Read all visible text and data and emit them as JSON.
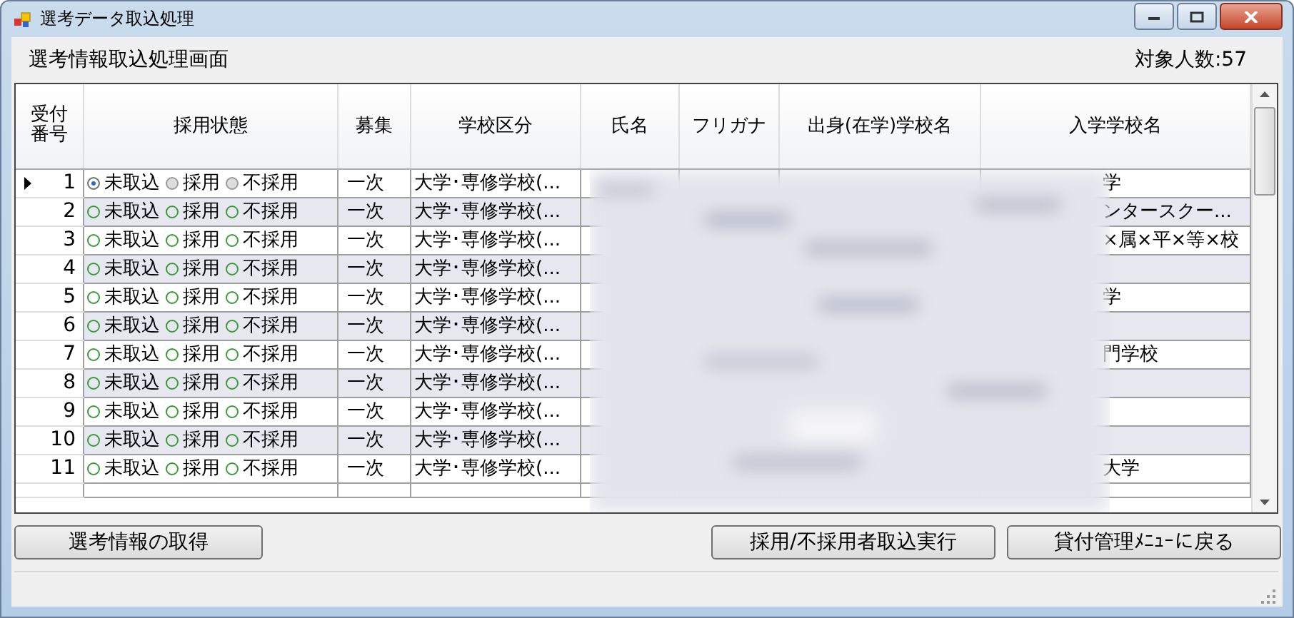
{
  "window": {
    "title": "選考データ取込処理"
  },
  "heading": "選考情報取込処理画面",
  "target_count": "対象人数:57",
  "table": {
    "columns": [
      "受付番号",
      "採用状態",
      "募集",
      "学校区分",
      "氏名",
      "フリガナ",
      "出身(在学)学校名",
      "入学学校名"
    ],
    "rows": [
      {
        "number": "1",
        "current": true,
        "options": [
          {
            "label": "未取込",
            "selected": true
          },
          {
            "label": "採用",
            "selected": false
          },
          {
            "label": "不採用",
            "selected": false
          }
        ],
        "recruitment": "一次",
        "school_type": "大学･専修学校(...",
        "admission_school": "学"
      },
      {
        "number": "2",
        "current": false,
        "options": [
          {
            "label": "未取込",
            "selected": false
          },
          {
            "label": "採用",
            "selected": false
          },
          {
            "label": "不採用",
            "selected": false
          }
        ],
        "recruitment": "一次",
        "school_type": "大学･専修学校(...",
        "admission_school": "ンタースクー..."
      },
      {
        "number": "3",
        "current": false,
        "options": [
          {
            "label": "未取込",
            "selected": false
          },
          {
            "label": "採用",
            "selected": false
          },
          {
            "label": "不採用",
            "selected": false
          }
        ],
        "recruitment": "一次",
        "school_type": "大学･専修学校(...",
        "admission_school": "×属×平×等×校"
      },
      {
        "number": "4",
        "current": false,
        "options": [
          {
            "label": "未取込",
            "selected": false
          },
          {
            "label": "採用",
            "selected": false
          },
          {
            "label": "不採用",
            "selected": false
          }
        ],
        "recruitment": "一次",
        "school_type": "大学･専修学校(..."
      },
      {
        "number": "5",
        "current": false,
        "options": [
          {
            "label": "未取込",
            "selected": false
          },
          {
            "label": "採用",
            "selected": false
          },
          {
            "label": "不採用",
            "selected": false
          }
        ],
        "recruitment": "一次",
        "school_type": "大学･専修学校(...",
        "admission_school": "学"
      },
      {
        "number": "6",
        "current": false,
        "options": [
          {
            "label": "未取込",
            "selected": false
          },
          {
            "label": "採用",
            "selected": false
          },
          {
            "label": "不採用",
            "selected": false
          }
        ],
        "recruitment": "一次",
        "school_type": "大学･専修学校(..."
      },
      {
        "number": "7",
        "current": false,
        "options": [
          {
            "label": "未取込",
            "selected": false
          },
          {
            "label": "採用",
            "selected": false
          },
          {
            "label": "不採用",
            "selected": false
          }
        ],
        "recruitment": "一次",
        "school_type": "大学･専修学校(...",
        "admission_school": "門学校"
      },
      {
        "number": "8",
        "current": false,
        "options": [
          {
            "label": "未取込",
            "selected": false
          },
          {
            "label": "採用",
            "selected": false
          },
          {
            "label": "不採用",
            "selected": false
          }
        ],
        "recruitment": "一次",
        "school_type": "大学･専修学校(..."
      },
      {
        "number": "9",
        "current": false,
        "options": [
          {
            "label": "未取込",
            "selected": false
          },
          {
            "label": "採用",
            "selected": false
          },
          {
            "label": "不採用",
            "selected": false
          }
        ],
        "recruitment": "一次",
        "school_type": "大学･専修学校(..."
      },
      {
        "number": "10",
        "current": false,
        "options": [
          {
            "label": "未取込",
            "selected": false
          },
          {
            "label": "採用",
            "selected": false
          },
          {
            "label": "不採用",
            "selected": false
          }
        ],
        "recruitment": "一次",
        "school_type": "大学･専修学校(..."
      },
      {
        "number": "11",
        "current": false,
        "options": [
          {
            "label": "未取込",
            "selected": false
          },
          {
            "label": "採用",
            "selected": false
          },
          {
            "label": "不採用",
            "selected": false
          }
        ],
        "recruitment": "一次",
        "school_type": "大学･専修学校(...",
        "admission_school": "大学"
      }
    ]
  },
  "buttons": [
    {
      "label": "選考情報の取得",
      "kind": "left"
    },
    {
      "label": "採用/不採用者取込実行",
      "kind": "right"
    },
    {
      "label": "貸付管理ﾒﾆｭｰに戻る",
      "kind": "right"
    }
  ]
}
